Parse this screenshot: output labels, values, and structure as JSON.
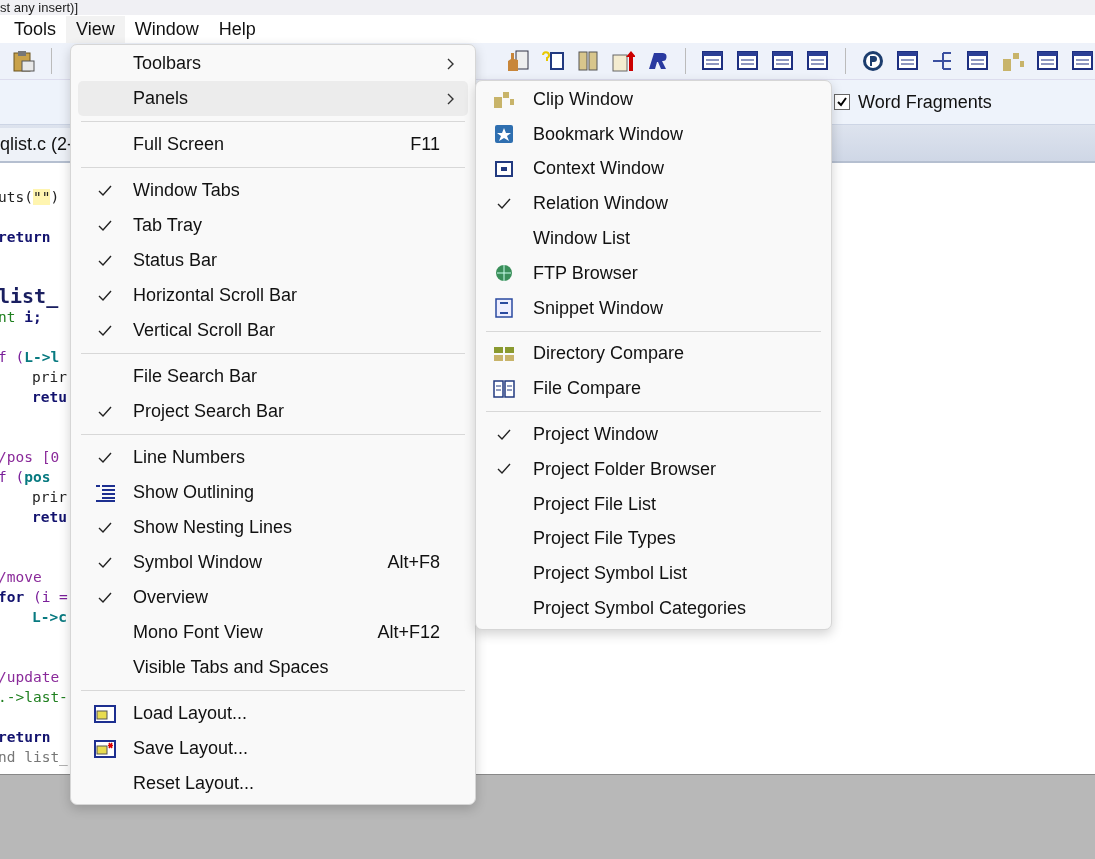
{
  "title_strip": "st any insert)]",
  "menu_bar": [
    {
      "label": "Tools",
      "selected": false
    },
    {
      "label": "View",
      "selected": true
    },
    {
      "label": "Window",
      "selected": false
    },
    {
      "label": "Help",
      "selected": false
    }
  ],
  "search_bar": {
    "word_fragments": {
      "label": "Word Fragments",
      "checked": true
    }
  },
  "tab": {
    "label": "qlist.c (2-"
  },
  "code_lines": [
    {
      "kind": "blank"
    },
    {
      "kind": "code",
      "tokens": [
        {
          "t": "uts(",
          "kind": "plain"
        },
        {
          "t": "\"\"",
          "kind": "string"
        },
        {
          "t": ")",
          "kind": "plain"
        }
      ]
    },
    {
      "kind": "blank"
    },
    {
      "kind": "code",
      "tokens": [
        {
          "t": "return",
          "kind": "keyword"
        }
      ]
    },
    {
      "kind": "blank"
    },
    {
      "kind": "blank"
    },
    {
      "kind": "heading",
      "tokens": [
        {
          "t": "list_",
          "kind": "name"
        }
      ]
    },
    {
      "kind": "code",
      "tokens": [
        {
          "t": "nt ",
          "kind": "type"
        },
        {
          "t": "i;",
          "kind": "keyword"
        }
      ]
    },
    {
      "kind": "blank"
    },
    {
      "kind": "code",
      "tokens": [
        {
          "t": "f (",
          "kind": "control"
        },
        {
          "t": "L->l",
          "kind": "member"
        }
      ]
    },
    {
      "kind": "code",
      "indent": true,
      "tokens": [
        {
          "t": "prir",
          "kind": "plain"
        }
      ]
    },
    {
      "kind": "code",
      "indent": true,
      "tokens": [
        {
          "t": "retu",
          "kind": "keyword"
        }
      ]
    },
    {
      "kind": "blank"
    },
    {
      "kind": "blank"
    },
    {
      "kind": "code",
      "tokens": [
        {
          "t": "/pos [0",
          "kind": "comment"
        }
      ]
    },
    {
      "kind": "code",
      "tokens": [
        {
          "t": "f (",
          "kind": "control"
        },
        {
          "t": "pos",
          "kind": "member"
        }
      ]
    },
    {
      "kind": "code",
      "indent": true,
      "tokens": [
        {
          "t": "prir",
          "kind": "plain"
        }
      ]
    },
    {
      "kind": "code",
      "indent": true,
      "tokens": [
        {
          "t": "retu",
          "kind": "keyword"
        }
      ]
    },
    {
      "kind": "blank"
    },
    {
      "kind": "blank"
    },
    {
      "kind": "code",
      "tokens": [
        {
          "t": "/move",
          "kind": "comment"
        }
      ]
    },
    {
      "kind": "code",
      "tokens": [
        {
          "t": "for ",
          "kind": "keyword"
        },
        {
          "t": "(i =",
          "kind": "control"
        }
      ]
    },
    {
      "kind": "code",
      "indent": true,
      "tokens": [
        {
          "t": "L->c",
          "kind": "member"
        }
      ]
    },
    {
      "kind": "blank"
    },
    {
      "kind": "blank"
    },
    {
      "kind": "code",
      "tokens": [
        {
          "t": "/update",
          "kind": "comment"
        }
      ]
    },
    {
      "kind": "code",
      "tokens": [
        {
          "t": ".->last-",
          "kind": "type"
        }
      ]
    },
    {
      "kind": "blank"
    },
    {
      "kind": "code",
      "tokens": [
        {
          "t": "return",
          "kind": "keyword"
        }
      ]
    },
    {
      "kind": "code",
      "tokens": [
        {
          "t": "nd list_",
          "kind": "faint"
        }
      ]
    }
  ],
  "view_menu": [
    {
      "kind": "item",
      "label": "Toolbars",
      "checked": false,
      "submenu": true,
      "selected": false
    },
    {
      "kind": "item",
      "label": "Panels",
      "checked": false,
      "submenu": true,
      "selected": true
    },
    {
      "kind": "separator"
    },
    {
      "kind": "item",
      "label": "Full Screen",
      "checked": false,
      "shortcut": "F11",
      "selected": false
    },
    {
      "kind": "separator"
    },
    {
      "kind": "item",
      "label": "Window Tabs",
      "checked": true,
      "selected": false
    },
    {
      "kind": "item",
      "label": "Tab Tray",
      "checked": true,
      "selected": false
    },
    {
      "kind": "item",
      "label": "Status Bar",
      "checked": true,
      "selected": false
    },
    {
      "kind": "item",
      "label": "Horizontal Scroll Bar",
      "checked": true,
      "selected": false
    },
    {
      "kind": "item",
      "label": "Vertical Scroll Bar",
      "checked": true,
      "selected": false
    },
    {
      "kind": "separator"
    },
    {
      "kind": "item",
      "label": "File Search Bar",
      "checked": false,
      "selected": false
    },
    {
      "kind": "item",
      "label": "Project Search Bar",
      "checked": true,
      "selected": false
    },
    {
      "kind": "separator"
    },
    {
      "kind": "item",
      "label": "Line Numbers",
      "checked": true,
      "selected": false
    },
    {
      "kind": "item",
      "label": "Show Outlining",
      "checked": false,
      "selected": false
    },
    {
      "kind": "item",
      "label": "Show Nesting Lines",
      "checked": true,
      "selected": false
    },
    {
      "kind": "item",
      "label": "Symbol Window",
      "checked": true,
      "shortcut": "Alt+F8",
      "selected": false
    },
    {
      "kind": "item",
      "label": "Overview",
      "checked": true,
      "selected": false
    },
    {
      "kind": "item",
      "label": "Mono Font View",
      "checked": false,
      "shortcut": "Alt+F12",
      "selected": false
    },
    {
      "kind": "item",
      "label": "Visible Tabs and Spaces",
      "checked": false,
      "selected": false
    },
    {
      "kind": "separator"
    },
    {
      "kind": "item",
      "label": "Load Layout...",
      "checked": false,
      "selected": false
    },
    {
      "kind": "item",
      "label": "Save Layout...",
      "checked": false,
      "selected": false
    },
    {
      "kind": "item",
      "label": "Reset Layout...",
      "checked": false,
      "selected": false
    }
  ],
  "panels_submenu": [
    {
      "kind": "item",
      "label": "Clip Window",
      "checked": false
    },
    {
      "kind": "item",
      "label": "Bookmark Window",
      "checked": false
    },
    {
      "kind": "item",
      "label": "Context Window",
      "checked": false
    },
    {
      "kind": "item",
      "label": "Relation Window",
      "checked": true
    },
    {
      "kind": "item",
      "label": "Window List",
      "checked": false
    },
    {
      "kind": "item",
      "label": "FTP Browser",
      "checked": false
    },
    {
      "kind": "item",
      "label": "Snippet Window",
      "checked": false
    },
    {
      "kind": "separator"
    },
    {
      "kind": "item",
      "label": "Directory Compare",
      "checked": false
    },
    {
      "kind": "item",
      "label": "File Compare",
      "checked": false
    },
    {
      "kind": "separator"
    },
    {
      "kind": "item",
      "label": "Project Window",
      "checked": true
    },
    {
      "kind": "item",
      "label": "Project Folder Browser",
      "checked": true
    },
    {
      "kind": "item",
      "label": "Project File List",
      "checked": false
    },
    {
      "kind": "item",
      "label": "Project File Types",
      "checked": false
    },
    {
      "kind": "item",
      "label": "Project Symbol List",
      "checked": false
    },
    {
      "kind": "item",
      "label": "Project Symbol Categories",
      "checked": false
    }
  ]
}
